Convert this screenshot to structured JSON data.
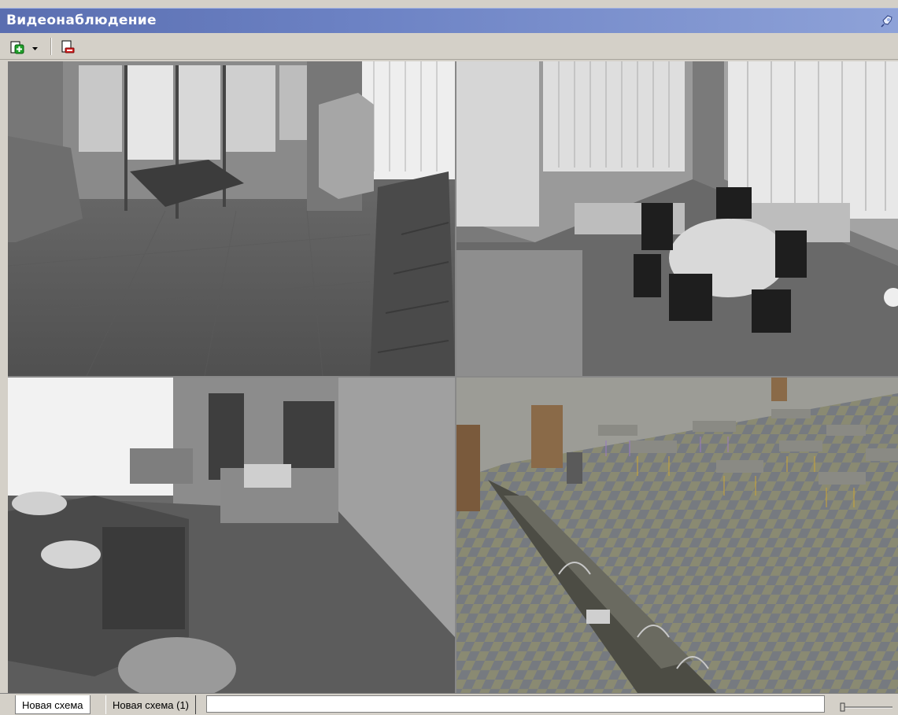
{
  "window": {
    "title": "Видеонаблюдение",
    "pin_icon": "pin-icon",
    "title_gradient": [
      "#5a6eb0",
      "#8ea2d8"
    ]
  },
  "toolbar": {
    "items": [
      {
        "name": "add-camera-button",
        "icon": "add-icon"
      },
      {
        "name": "add-dropdown-button",
        "icon": "chevron-down-icon"
      },
      {
        "name": "remove-camera-button",
        "icon": "remove-icon"
      }
    ]
  },
  "cameras": [
    {
      "name": "camera-lobby",
      "scene": "lobby entrance"
    },
    {
      "name": "camera-meeting-room",
      "scene": "round table meeting room"
    },
    {
      "name": "camera-office",
      "scene": "open office"
    },
    {
      "name": "camera-cafeteria",
      "scene": "cafeteria"
    }
  ],
  "tabs": [
    {
      "label": "Новая схема",
      "active": true
    },
    {
      "label": "Новая схема (1)",
      "active": false
    }
  ],
  "zoom_slider": {
    "value": 0
  }
}
